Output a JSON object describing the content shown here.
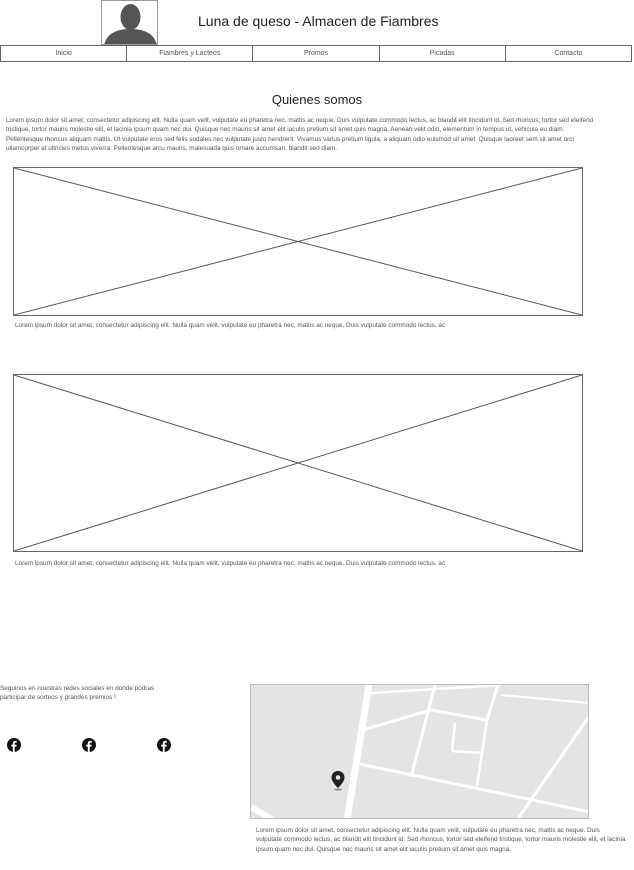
{
  "header": {
    "title": "Luna de queso - Almacen de Fiambres",
    "logo_icon": "user-silhouette-icon"
  },
  "nav": {
    "items": [
      "Inicio",
      "Fiambres y Lacteos",
      "Promos",
      "Picadas",
      "Contacto"
    ]
  },
  "main": {
    "section_title": "Quienes somos",
    "intro": "Lorem ipsum dolor sit amet, consectetur adipiscing elit. Nulla quam velit, vulputate eu pharetra nec, mattis ac neque. Duis vulputate commodo lectus, ac blandit elit tincidunt id. Sed rhoncus, tortor sed eleifend tristique, tortor mauris molestie elit, et lacinia ipsum quam nec dui. Quisque nec mauris sit amet elit iaculis pretium sit amet quis magna. Aenean velit odio, elementum in tempus ut, vehicula eu diam. Pellentesque rhoncus aliquam mattis. Ut vulputate eros sed felis sodales nec vulputate justo hendrerit. Vivamus varius pretium ligula, a aliquam odio euismod sit amet. Quisque laoreet sem sit amet orci ullamcorper at ultricies metus viverra. Pellentesque arcu mauris, malesuada quis ornare accumsan, blandit sed diam.",
    "images": [
      {
        "caption": "Lorem ipsum dolor sit amet, consectetur adipiscing elit. Nulla quam velit, vulputate eu pharetra nec, mattis ac neque. Duis vulputate commodo lectus, ac"
      },
      {
        "caption": "Lorem ipsum dolor sit amet, consectetur adipiscing elit. Nulla quam velit, vulputate eu pharetra nec, mattis ac neque. Duis vulputate commodo lectus, ac"
      }
    ]
  },
  "footer": {
    "social_text": "Seguinos en nuestras redes sociales en donde podras participar de sorteos y grandes premios !",
    "social_icons": [
      "facebook-icon",
      "facebook-icon",
      "facebook-icon"
    ],
    "map_icon": "map-pin-icon",
    "map_text": "Lorem ipsum dolor sit amet, consectetur adipiscing elit. Nulla quam velit, vulputate eu pharetra nec, mattis ac neque. Duis vulputate commodo lectus, ac blandit elit tincidunt id. Sed rhoncus, tortor sed eleifend tristique, tortor mauris molestie elit, et lacinia ipsum quam nec dui. Quisque nec mauris sit amet elit iaculis pretium sit amet quis magna."
  }
}
